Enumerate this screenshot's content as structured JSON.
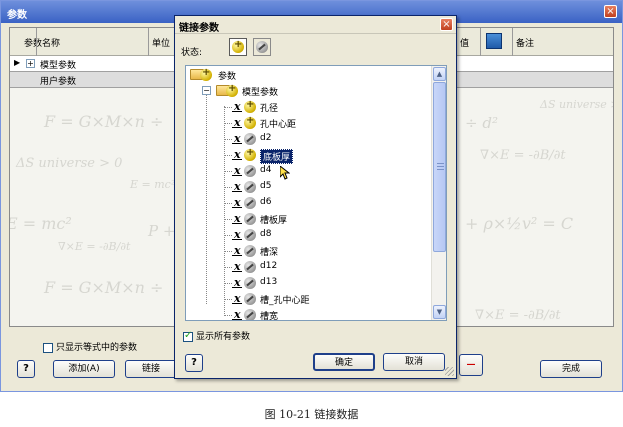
{
  "main_window": {
    "title": "参数",
    "close_glyph": "×",
    "columns": [
      "参数名称",
      "单位",
      "值",
      "备注"
    ],
    "rows": [
      {
        "pointer": "▶",
        "name": "模型参数"
      },
      {
        "pointer": "",
        "name": "用户参数"
      }
    ],
    "watermark_formulas": [
      "F = G×M×n ÷",
      "ΔS universe > 0",
      "E = mc²",
      "E = mc²",
      "P +",
      "∇×E = -∂B/∂t",
      "F = G×M×n ÷",
      "ΔS universe > 0",
      "÷ d²",
      "∇×E = -∂B/∂t",
      "+ ρ×½v² = C",
      "∇×E = -∂B/∂t"
    ],
    "show_equations_only_label": "只显示等式中的参数",
    "help_glyph": "?",
    "add_button": "添加(A)",
    "link_button": "链接",
    "done_button": "完成",
    "remove_glyph": "—"
  },
  "dialog": {
    "title": "链接参数",
    "close_glyph": "×",
    "status_label": "状态:",
    "tree": {
      "root": "参数",
      "group": "模型参数",
      "items": [
        {
          "label": "孔径",
          "active": true,
          "selected": false
        },
        {
          "label": "孔中心距",
          "active": true,
          "selected": false
        },
        {
          "label": "d2",
          "active": false,
          "selected": false
        },
        {
          "label": "底板厚",
          "active": true,
          "selected": true
        },
        {
          "label": "d4",
          "active": false,
          "selected": false
        },
        {
          "label": "d5",
          "active": false,
          "selected": false
        },
        {
          "label": "d6",
          "active": false,
          "selected": false
        },
        {
          "label": "槽板厚",
          "active": false,
          "selected": false
        },
        {
          "label": "d8",
          "active": false,
          "selected": false
        },
        {
          "label": "槽深",
          "active": false,
          "selected": false
        },
        {
          "label": "d12",
          "active": false,
          "selected": false
        },
        {
          "label": "d13",
          "active": false,
          "selected": false
        },
        {
          "label": "槽_孔中心距",
          "active": false,
          "selected": false
        },
        {
          "label": "槽宽",
          "active": false,
          "selected": false
        }
      ]
    },
    "show_all_label": "显示所有参数",
    "help_glyph": "?",
    "ok_button": "确定",
    "cancel_button": "取消"
  },
  "caption": "图 10-21   链接数据",
  "colors": {
    "title_blue": "#3a62c4",
    "selection": "#0a246a",
    "active_dot": "#d2b000",
    "inactive_dot": "#9a9a9a"
  }
}
